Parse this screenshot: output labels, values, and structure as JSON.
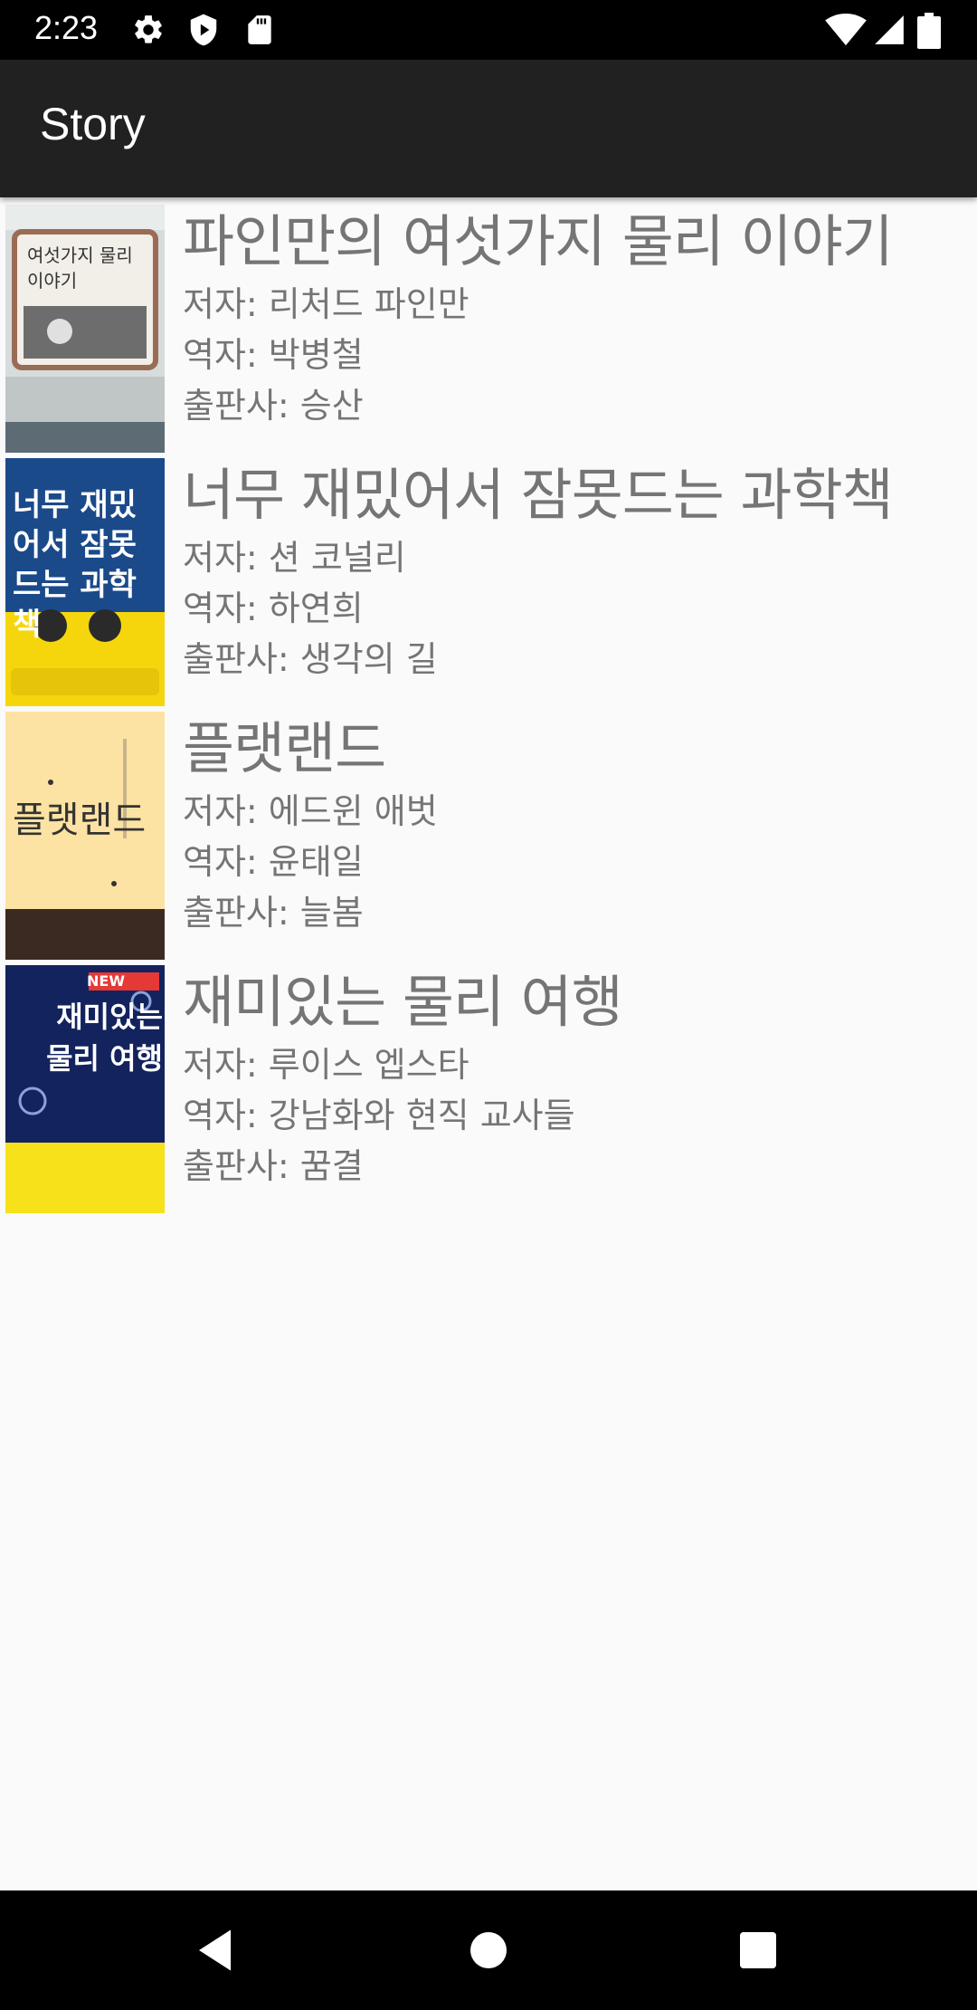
{
  "status_bar": {
    "time": "2:23",
    "icons": [
      "gear-icon",
      "shield-play-icon",
      "sd-card-icon",
      "wifi-icon",
      "signal-icon",
      "battery-icon"
    ]
  },
  "app_bar": {
    "title": "Story"
  },
  "books": [
    {
      "title": "파인만의 여섯가지 물리 이야기",
      "author": "저자: 리처드 파인만",
      "translator": "역자: 박병철",
      "publisher": "출판사: 승산",
      "cover_text": "여섯가지 물리이야기",
      "cover_bg": "#cfd8d8"
    },
    {
      "title": "너무 재밌어서 잠못드는 과학책",
      "author": "저자: 션 코널리",
      "translator": "역자: 하연희",
      "publisher": "출판사: 생각의 길",
      "cover_text": "너무 재밌어서 잠못드는 과학책",
      "cover_bg": "#1b4a8a"
    },
    {
      "title": "플랫랜드",
      "author": "저자: 에드윈 애벗",
      "translator": "역자: 윤태일",
      "publisher": "출판사: 늘봄",
      "cover_text": "플랫랜드",
      "cover_bg": "#fde3a3"
    },
    {
      "title": "재미있는 물리 여행",
      "author": "저자: 루이스 엡스타",
      "translator": "역자: 강남화와 현직 교사들",
      "publisher": "출판사: 꿈결",
      "cover_text": "재미있는 물리 여행",
      "cover_badge": "NEW",
      "cover_bg": "#13235e"
    }
  ],
  "nav_bar": {
    "buttons": [
      "back-icon",
      "home-icon",
      "recents-icon"
    ]
  }
}
